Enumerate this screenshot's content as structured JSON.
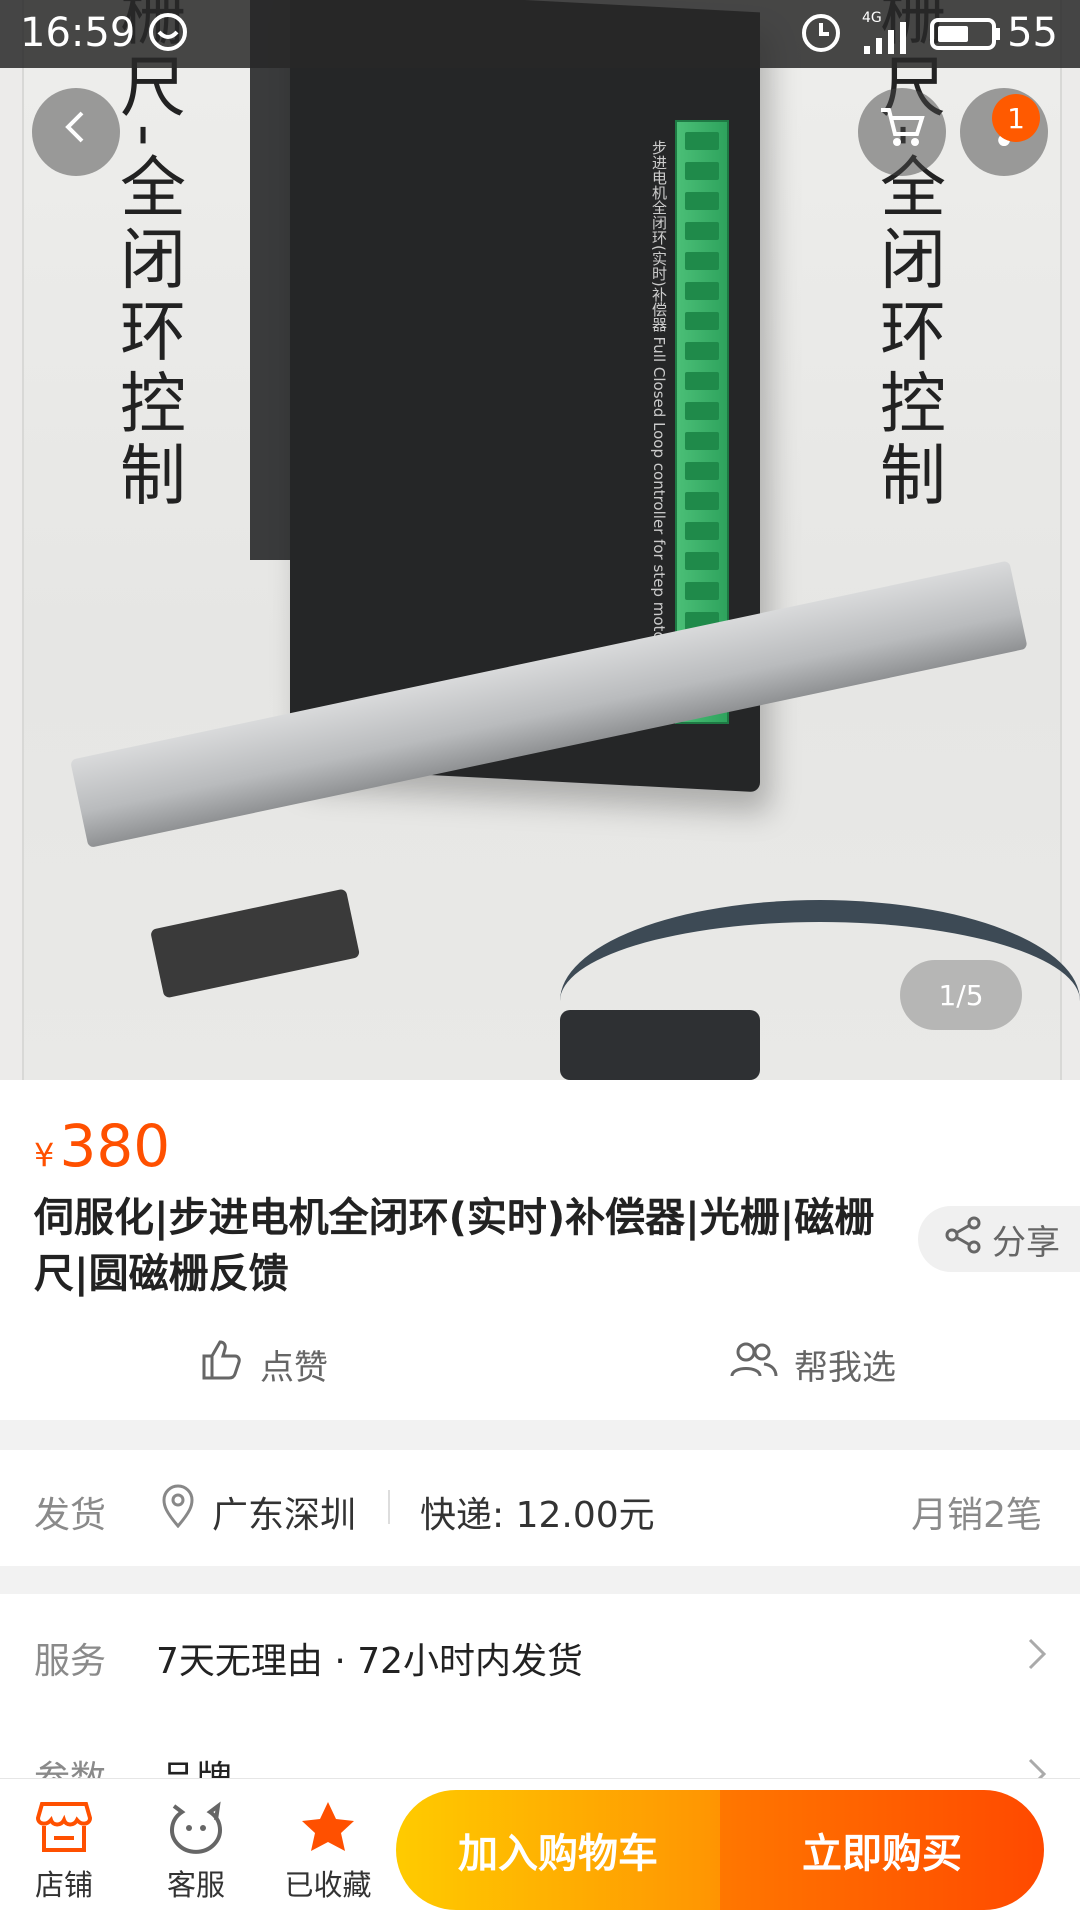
{
  "status_bar": {
    "time": "16:59",
    "network": "4G",
    "battery": "55"
  },
  "hero": {
    "vertical_text_left": "栅尺-全闭环控制",
    "vertical_text_right": "栅尺-全闭环控制",
    "device_label": "步进电机全闭环(实时)补偿器 Full Closed Loop controller for step motor",
    "image_counter": "1/5"
  },
  "header": {
    "cart_badge": "1"
  },
  "product": {
    "currency": "¥",
    "price": "380",
    "title": "伺服化|步进电机全闭环(实时)补偿器|光栅|磁栅尺|圆磁栅反馈",
    "share_label": "分享",
    "like_label": "点赞",
    "help_choose_label": "帮我选"
  },
  "shipping": {
    "label": "发货",
    "location": "广东深圳",
    "delivery": "快递: 12.00元",
    "monthly_sales": "月销2笔"
  },
  "service": {
    "label": "服务",
    "value": "7天无理由 · 72小时内发货",
    "params_label": "参数",
    "params_value": "品牌"
  },
  "bottom_bar": {
    "shop_label": "店铺",
    "support_label": "客服",
    "favorite_label": "已收藏",
    "add_to_cart": "加入购物车",
    "buy_now": "立即购买"
  },
  "colors": {
    "accent": "#ff5000",
    "cart_gradient_start": "#ffcb00",
    "buy_gradient_end": "#ff4900"
  }
}
